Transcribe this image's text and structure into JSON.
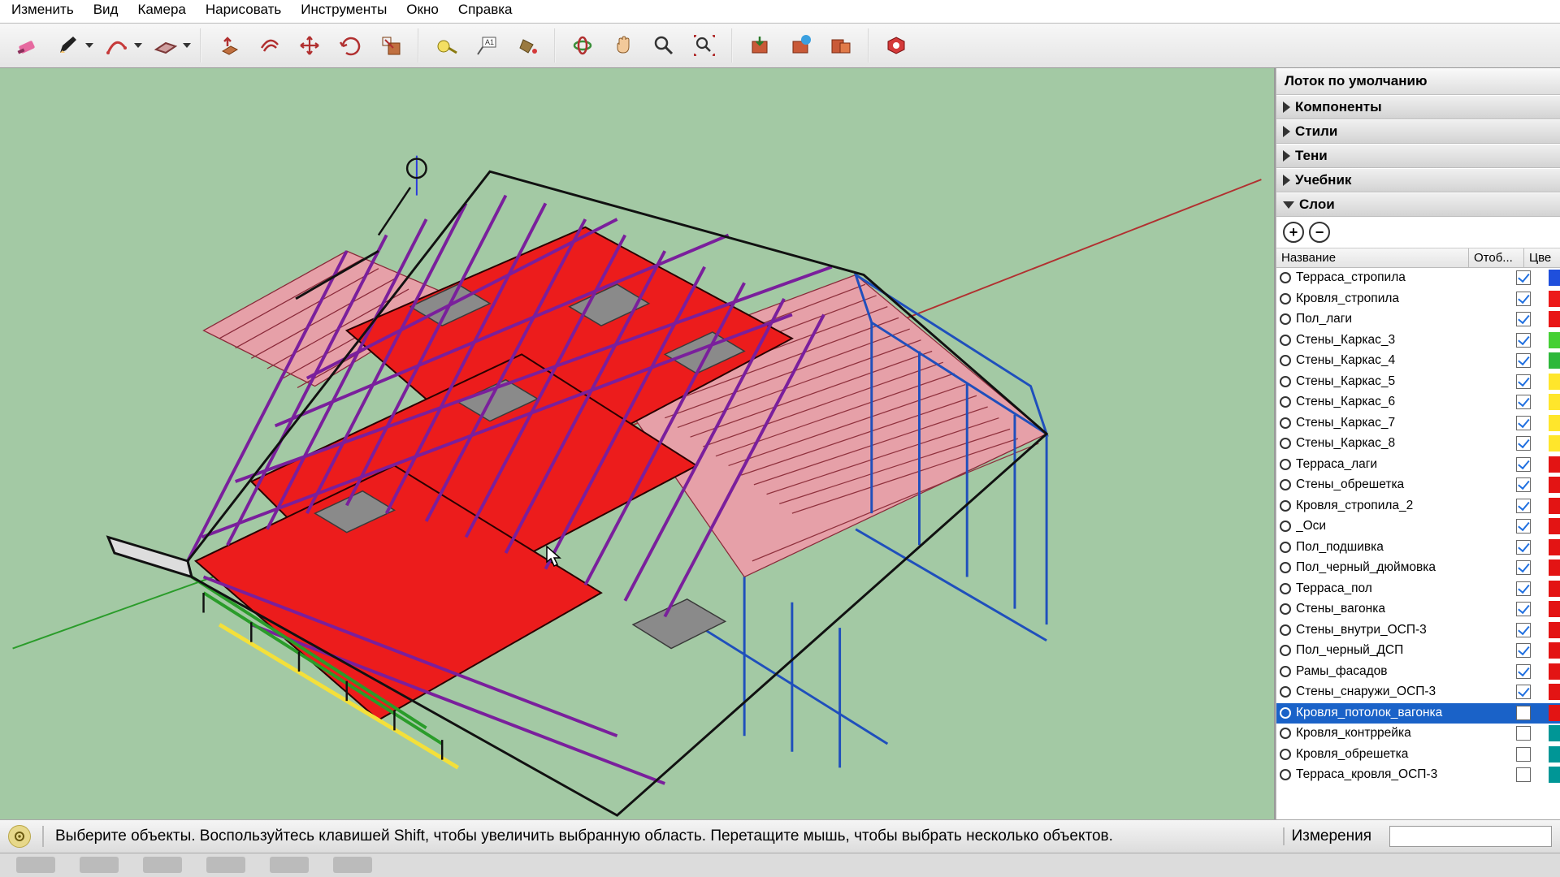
{
  "menu": {
    "items": [
      "Изменить",
      "Вид",
      "Камера",
      "Нарисовать",
      "Инструменты",
      "Окно",
      "Справка"
    ]
  },
  "toolbar_groups": [
    [
      "eraser",
      "pencil",
      "pencil-drop",
      "arc",
      "arc-drop",
      "rect",
      "rect-drop"
    ],
    [
      "pushpull",
      "offset",
      "move",
      "rotate",
      "scale"
    ],
    [
      "tape",
      "text-label",
      "paint"
    ],
    [
      "orbit",
      "pan",
      "zoom",
      "zoom-extents"
    ],
    [
      "warehouse-get",
      "warehouse-share",
      "warehouse-models"
    ],
    [
      "extension"
    ]
  ],
  "tray": {
    "title": "Лоток по умолчанию",
    "panels": [
      "Компоненты",
      "Стили",
      "Тени",
      "Учебник",
      "Слои"
    ],
    "expanded": "Слои"
  },
  "layers": {
    "header": {
      "name": "Название",
      "visible": "Отоб...",
      "color": "Цве"
    },
    "rows": [
      {
        "name": "Терраса_стропила",
        "visible": true,
        "color": "#1f4fdc",
        "selected": false
      },
      {
        "name": "Кровля_стропила",
        "visible": true,
        "color": "#ec1a1a",
        "selected": false
      },
      {
        "name": "Пол_лаги",
        "visible": true,
        "color": "#e81616",
        "selected": false
      },
      {
        "name": "Стены_Каркас_3",
        "visible": true,
        "color": "#45d034",
        "selected": false
      },
      {
        "name": "Стены_Каркас_4",
        "visible": true,
        "color": "#2db83a",
        "selected": false
      },
      {
        "name": "Стены_Каркас_5",
        "visible": true,
        "color": "#ffe62b",
        "selected": false
      },
      {
        "name": "Стены_Каркас_6",
        "visible": true,
        "color": "#ffe62b",
        "selected": false
      },
      {
        "name": "Стены_Каркас_7",
        "visible": true,
        "color": "#ffe62b",
        "selected": false
      },
      {
        "name": "Стены_Каркас_8",
        "visible": true,
        "color": "#ffe62b",
        "selected": false
      },
      {
        "name": "Терраса_лаги",
        "visible": true,
        "color": "#e31414",
        "selected": false
      },
      {
        "name": "Стены_обрешетка",
        "visible": true,
        "color": "#e31414",
        "selected": false
      },
      {
        "name": "Кровля_стропила_2",
        "visible": true,
        "color": "#e31414",
        "selected": false
      },
      {
        "name": "_Оси",
        "visible": true,
        "color": "#e31414",
        "selected": false
      },
      {
        "name": "Пол_подшивка",
        "visible": true,
        "color": "#e31414",
        "selected": false
      },
      {
        "name": "Пол_черный_дюймовка",
        "visible": true,
        "color": "#e31414",
        "selected": false
      },
      {
        "name": "Терраса_пол",
        "visible": true,
        "color": "#e31414",
        "selected": false
      },
      {
        "name": "Стены_вагонка",
        "visible": true,
        "color": "#e31414",
        "selected": false
      },
      {
        "name": "Стены_внутри_ОСП-3",
        "visible": true,
        "color": "#e31414",
        "selected": false
      },
      {
        "name": "Пол_черный_ДСП",
        "visible": true,
        "color": "#e31414",
        "selected": false
      },
      {
        "name": "Рамы_фасадов",
        "visible": true,
        "color": "#e31414",
        "selected": false
      },
      {
        "name": "Стены_снаружи_ОСП-3",
        "visible": true,
        "color": "#e31414",
        "selected": false
      },
      {
        "name": "Кровля_потолок_вагонка",
        "visible": false,
        "color": "#e31414",
        "selected": true
      },
      {
        "name": "Кровля_контррейка",
        "visible": false,
        "color": "#009696",
        "selected": false
      },
      {
        "name": "Кровля_обрешетка",
        "visible": false,
        "color": "#009696",
        "selected": false
      },
      {
        "name": "Терраса_кровля_ОСП-3",
        "visible": false,
        "color": "#009696",
        "selected": false
      }
    ]
  },
  "status": {
    "hint": "Выберите объекты. Воспользуйтесь клавишей Shift, чтобы увеличить выбранную область. Перетащите мышь, чтобы выбрать несколько объектов.",
    "measure_label": "Измерения"
  }
}
